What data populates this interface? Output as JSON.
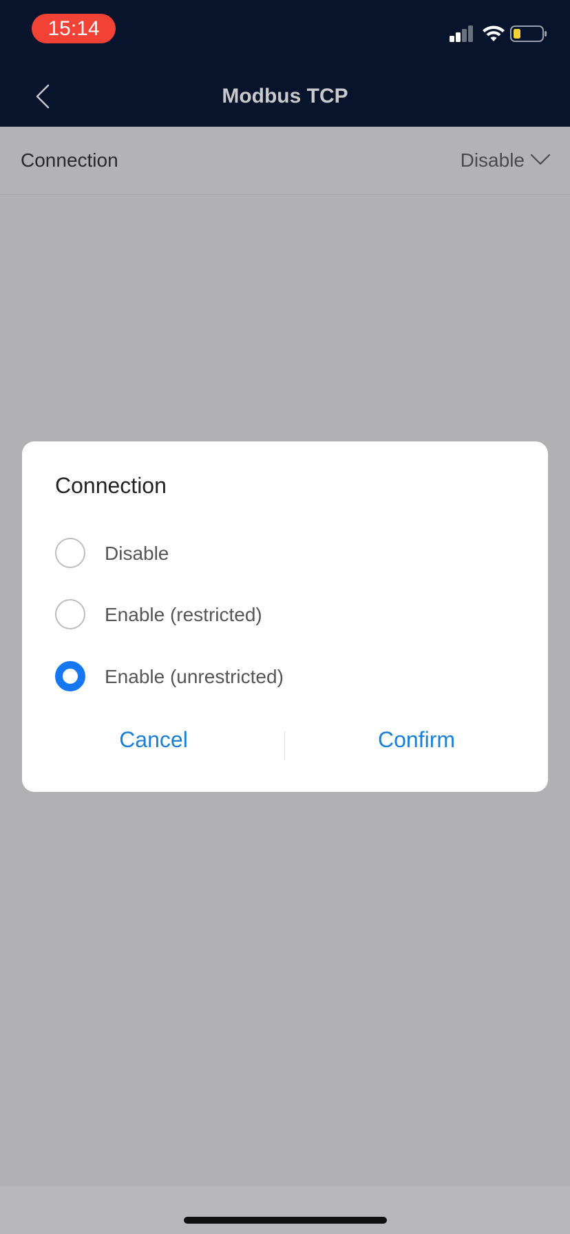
{
  "status_bar": {
    "time": "15:14",
    "icons": [
      "cellular-signal-icon",
      "wifi-icon",
      "battery-low-icon"
    ],
    "time_pill_color": "#f24236",
    "battery_fill_color": "#f5d23a"
  },
  "header": {
    "title": "Modbus TCP",
    "back_icon": "chevron-left-icon",
    "background": "#08132c"
  },
  "settings": {
    "connection": {
      "label": "Connection",
      "value": "Disable",
      "icon": "chevron-down-icon"
    }
  },
  "dialog": {
    "title": "Connection",
    "options": [
      {
        "label": "Disable",
        "selected": false
      },
      {
        "label": "Enable (restricted)",
        "selected": false
      },
      {
        "label": "Enable (unrestricted)",
        "selected": true
      }
    ],
    "cancel_label": "Cancel",
    "confirm_label": "Confirm",
    "accent_color": "#1677f3"
  }
}
